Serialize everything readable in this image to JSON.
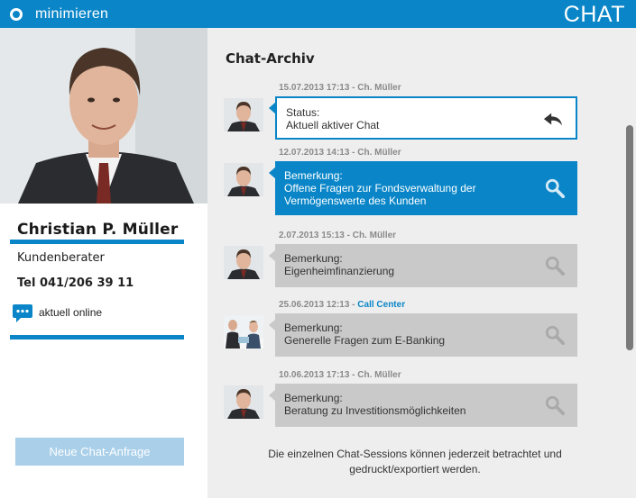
{
  "topbar": {
    "minimize_label": "minimieren",
    "title": "CHAT",
    "accent": "#0a86c8"
  },
  "profile": {
    "name": "Christian P. Müller",
    "role": "Kundenberater",
    "phone": "Tel 041/206 39 11",
    "status": "aktuell online",
    "status_icon": "chat-bubble-icon",
    "new_chat_label": "Neue Chat-Anfrage"
  },
  "archive": {
    "title": "Chat-Archiv",
    "entries": [
      {
        "date": "15.07.2013 17:13 - Ch. Müller",
        "cc": "",
        "line1": "Status:",
        "line2": "Aktuell aktiver Chat",
        "line3": "",
        "action_icon": "reply-icon",
        "state": "active"
      },
      {
        "date": "12.07.2013 14:13 - Ch. Müller",
        "cc": "",
        "line1": "Bemerkung:",
        "line2": "Offene Fragen zur Fondsverwaltung der",
        "line3": "Vermögenswerte des Kunden",
        "action_icon": "search-icon",
        "state": "highlight"
      },
      {
        "date": "2.07.2013 15:13 - Ch. Müller",
        "cc": "",
        "line1": "Bemerkung:",
        "line2": "Eigenheimfinanzierung",
        "line3": "",
        "action_icon": "search-icon",
        "state": "default"
      },
      {
        "date": "25.06.2013 12:13 - ",
        "cc": "Call Center",
        "line1": "Bemerkung:",
        "line2": "Generelle Fragen zum E-Banking",
        "line3": "",
        "action_icon": "search-icon",
        "state": "default"
      },
      {
        "date": "10.06.2013 17:13 - Ch. Müller",
        "cc": "",
        "line1": "Bemerkung:",
        "line2": "Beratung zu Investitionsmöglichkeiten",
        "line3": "",
        "action_icon": "search-icon",
        "state": "default"
      }
    ],
    "footer": "Die einzelnen Chat-Sessions können jederzeit betrachtet und gedruckt/exportiert werden."
  }
}
